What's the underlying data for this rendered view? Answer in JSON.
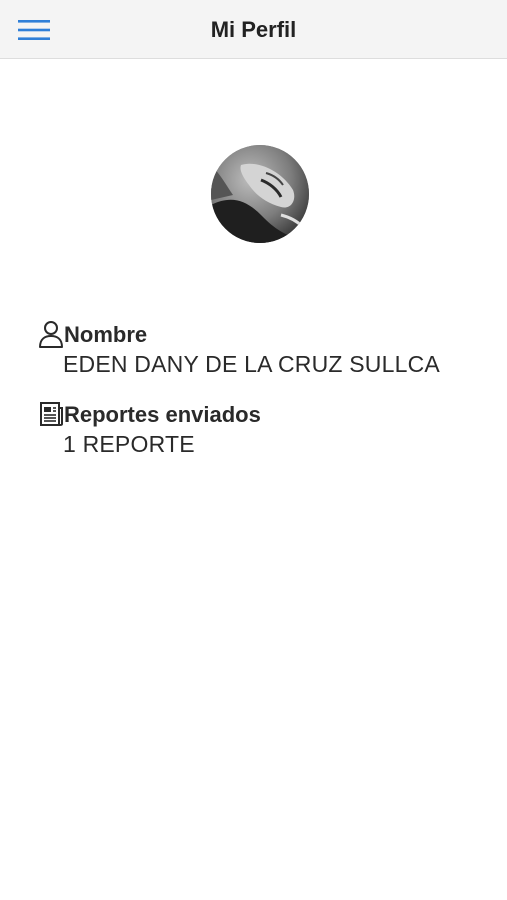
{
  "header": {
    "title": "Mi Perfil",
    "menu_icon": "hamburger-menu-icon",
    "accent_color": "#2f7fd8",
    "background": "#f4f4f4"
  },
  "profile": {
    "avatar_icon": "profile-photo"
  },
  "fields": [
    {
      "icon": "user-icon",
      "label": "Nombre",
      "value": "EDEN DANY DE LA CRUZ SULLCA"
    },
    {
      "icon": "newspaper-icon",
      "label": "Reportes enviados",
      "value": "1 REPORTE"
    }
  ]
}
